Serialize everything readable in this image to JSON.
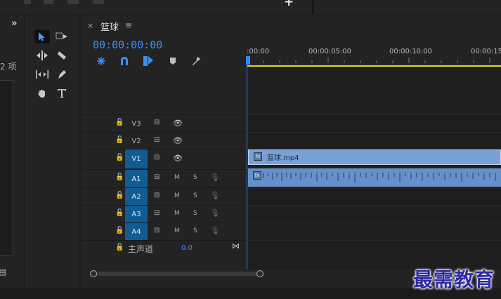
{
  "project": {
    "item_count": "2 项"
  },
  "sequence": {
    "tab_title": "篮球",
    "timecode": "00:00:00:00"
  },
  "ruler": {
    "labels": [
      ":00:00",
      "00:00:05:00",
      "00:00:10:00",
      "00:00:15"
    ]
  },
  "tracks": {
    "video": [
      {
        "name": "V3",
        "targeted": false
      },
      {
        "name": "V2",
        "targeted": false
      },
      {
        "name": "V1",
        "targeted": true
      }
    ],
    "audio": [
      {
        "name": "A1",
        "targeted": true,
        "m": "M",
        "s": "S"
      },
      {
        "name": "A2",
        "targeted": true,
        "m": "M",
        "s": "S"
      },
      {
        "name": "A3",
        "targeted": true,
        "m": "M",
        "s": "S"
      },
      {
        "name": "A4",
        "targeted": true,
        "m": "M",
        "s": "S"
      }
    ],
    "master": {
      "label": "主声道",
      "value": "0.0"
    }
  },
  "clips": {
    "video_label": "篮球.mp4",
    "fx_badge": "fx"
  },
  "colors": {
    "accent": "#3f8ff0",
    "clip_video": "#7aa1d6",
    "clip_audio": "#6690c9",
    "target": "#125c94",
    "work_area": "#e8d21a"
  },
  "watermark": "最需教育"
}
